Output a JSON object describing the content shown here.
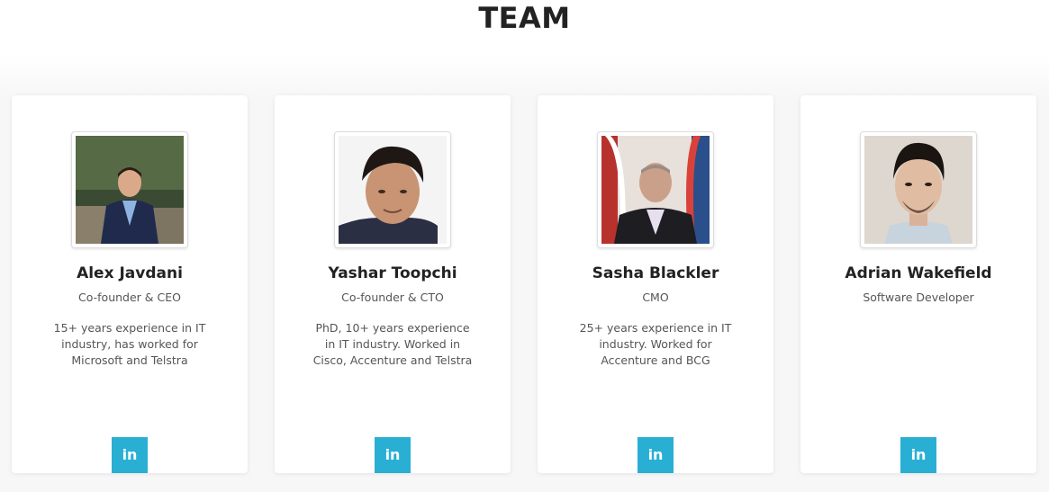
{
  "section": {
    "title": "TEAM"
  },
  "colors": {
    "accent": "#2aafd4",
    "card_bg": "#ffffff",
    "text_dark": "#222222"
  },
  "linkedin_glyph": "in",
  "members": [
    {
      "name": "Alex Javdani",
      "role": "Co-founder & CEO",
      "bio": "15+ years experience in IT industry, has worked for Microsoft and Telstra",
      "photo_icon": "portrait-photo"
    },
    {
      "name": "Yashar Toopchi",
      "role": "Co-founder & CTO",
      "bio": "PhD, 10+ years experience in IT industry. Worked in Cisco, Accenture and Telstra",
      "photo_icon": "portrait-photo"
    },
    {
      "name": "Sasha Blackler",
      "role": "CMO",
      "bio": "25+ years experience in IT industry. Worked for Accenture and BCG",
      "photo_icon": "portrait-photo"
    },
    {
      "name": "Adrian Wakefield",
      "role": "Software Developer",
      "bio": "",
      "photo_icon": "portrait-photo"
    }
  ]
}
